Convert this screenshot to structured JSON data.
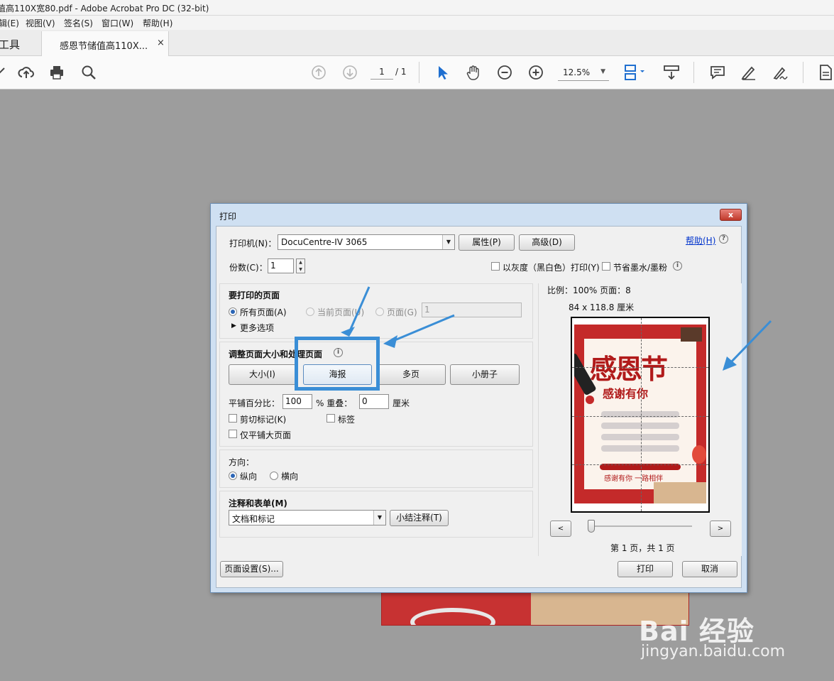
{
  "window": {
    "title": "值高110X宽80.pdf - Adobe Acrobat Pro DC (32-bit)"
  },
  "menubar": {
    "items": [
      "辑(E)",
      "视图(V)",
      "签名(S)",
      "窗口(W)",
      "帮助(H)"
    ]
  },
  "tabs": {
    "tools_label": "工具",
    "document_label": "感恩节储值高110X...",
    "close_glyph": "×"
  },
  "toolbar": {
    "page_current": "1",
    "page_total": "/ 1",
    "zoom": "12.5%",
    "zoom_caret": "▼",
    "icons": [
      "edit-icon",
      "cloud-upload-icon",
      "printer-icon",
      "search-icon",
      "page-up-icon",
      "page-down-icon",
      "select-arrow-icon",
      "hand-icon",
      "zoom-out-icon",
      "zoom-in-icon",
      "fit-width-icon",
      "scroll-mode-icon",
      "comment-icon",
      "highlight-pen-icon",
      "sign-icon",
      "export-pdf-icon"
    ]
  },
  "dialog": {
    "title": "打印",
    "close_glyph": "x",
    "printer_label": "打印机(N)：",
    "printer_value": "DocuCentre-IV 3065",
    "properties_button": "属性(P)",
    "advanced_button": "高级(D)",
    "help_link": "帮助(H)",
    "help_icon": "?",
    "copies_label": "份数(C)：",
    "copies_value": "1",
    "grayscale_label": "以灰度（黑白色）打印(Y)",
    "save_ink_label": "节省墨水/墨粉",
    "info_glyph": "i",
    "combo_arrow_glyph": "▼",
    "spin_up_glyph": "▲",
    "spin_down_glyph": "▼",
    "pages_section": {
      "title": "要打印的页面",
      "all_pages": "所有页面(A)",
      "current_page": "当前页面(U)",
      "pages": "页面(G)",
      "pages_value": "1",
      "more_options": "更多选项",
      "more_options_glyph": "▶"
    },
    "sizing_section": {
      "title": "调整页面大小和处理页面",
      "modes": [
        "大小(I)",
        "海报",
        "多页",
        "小册子"
      ],
      "active_mode": "海报",
      "tile_scale_label": "平铺百分比：",
      "tile_scale_value": "100",
      "overlap_label": "% 重叠：",
      "overlap_value": "0",
      "overlap_unit": "厘米",
      "cut_marks": "剪切标记(K)",
      "labels": "标签",
      "tile_large_only": "仅平铺大页面"
    },
    "orientation_section": {
      "title": "方向：",
      "portrait": "纵向",
      "landscape": "横向"
    },
    "annotations_section": {
      "title": "注释和表单(M)",
      "value": "文档和标记",
      "summarize_button": "小结注释(T)"
    },
    "preview": {
      "scale_text": "比例：100% 页面：8",
      "size_text": "84 x 118.8 厘米",
      "poster_title": "感恩节",
      "poster_subtitle": "感谢有你",
      "poster_slogan": "感谢有你  一路相伴",
      "prev_glyph": "<",
      "next_glyph": ">",
      "page_status": "第 1 页，共 1 页"
    },
    "page_setup_button": "页面设置(S)...",
    "print_button": "打印",
    "cancel_button": "取消"
  },
  "watermark": {
    "logo": "Bai 经验",
    "url": "jingyan.baidu.com"
  },
  "colors": {
    "annotation_blue": "#3a8ed6",
    "dialog_frame": "#cfe0f2",
    "canvas_gray": "#9d9d9d"
  }
}
